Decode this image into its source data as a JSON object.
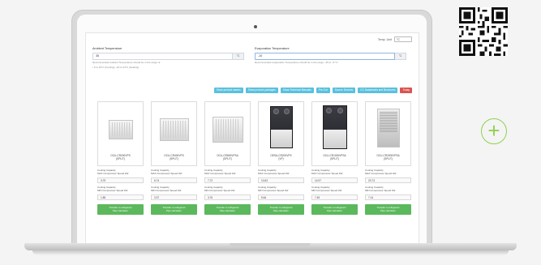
{
  "colors": {
    "primary_button": "#5bc0de",
    "danger_button": "#d9534f",
    "go_button": "#5cb85c",
    "accent_plus": "#8fd14f"
  },
  "units": {
    "label": "Temp. Unit",
    "value": "°C"
  },
  "ambient": {
    "label": "Ambient Temperature",
    "value": "35",
    "unit": "°C",
    "hint_line1": "Recommended ambient Temperature should be in the range of",
    "hint_line2": "• 5 to 43°C (Cooling)  –20 to 24°C (Heating)"
  },
  "evaporation": {
    "label": "Evaporation Temperature",
    "value": "-10",
    "unit": "°C",
    "hint": "Recommended evaporation Temperature should be in the range –45 to –5 °C"
  },
  "toolbar": [
    {
      "label": "Show product names",
      "color": "#5bc0de"
    },
    {
      "label": "Show product packages",
      "color": "#5bc0de"
    },
    {
      "label": "Show Technical Manuals",
      "color": "#5bc0de"
    },
    {
      "label": "Pre-Cut",
      "color": "#5bc0de"
    },
    {
      "label": "Source Devices",
      "color": "#5bc0de"
    },
    {
      "label": "CO Datasheets and Brochures",
      "color": "#5bc0de"
    },
    {
      "label": "Today",
      "color": "#d9534f"
    }
  ],
  "cards": [
    {
      "name": "OCU-CR200VPS",
      "model": "(SPLIT)",
      "image": "condensing-unit-small",
      "cap_label1": "Cooling Capacity",
      "cap_label1b": "MAX Compressor Speed kW",
      "cap_value": "3.79",
      "cap_label2": "Cooling Capacity",
      "cap_label2b": "MIN Compressor Speed kW",
      "cap_value2": "1.85",
      "button_line1": "Transfer to refrigerant",
      "button_line2": "Pipe calculator"
    },
    {
      "name": "OCU-CR400VPS",
      "model": "(SPLIT)",
      "image": "condensing-unit-medium",
      "cap_label1": "Cooling Capacity",
      "cap_label1b": "MAX Compressor Speed kW",
      "cap_value": "6.74",
      "cap_label2": "Cooling Capacity",
      "cap_label2b": "MIN Compressor Speed kW",
      "cap_value2": "3.37",
      "button_line1": "Transfer to refrigerant",
      "button_line2": "Pipe calculator"
    },
    {
      "name": "OCU-CR800VPSA",
      "model": "(SPLIT)",
      "image": "condensing-unit-large",
      "cap_label1": "Cooling Capacity",
      "cap_label1b": "MAX Compressor Speed kW",
      "cap_value": "7.72",
      "cap_label2": "Cooling Capacity",
      "cap_label2b": "MIN Compressor Speed kW",
      "cap_value2": "3.76",
      "button_line1": "Transfer to refrigerant",
      "button_line2": "Pipe calculator"
    },
    {
      "name": "OESA-CR200VPS",
      "model": "(VP)",
      "image": "vertical-unit-dark",
      "cap_label1": "Cooling Capacity",
      "cap_label1b": "MAX Compressor Speed kW",
      "cap_value": "10.63",
      "cap_label2": "Cooling Capacity",
      "cap_label2b": "MIN Compressor Speed kW",
      "cap_value2": "5.64",
      "button_line1": "Transfer to refrigerant",
      "button_line2": "Pipe calculator"
    },
    {
      "name": "OCU-CR1000VPSA",
      "model": "(SPLIT)",
      "image": "vertical-unit-dark-2",
      "cap_label1": "Cooling Capacity",
      "cap_label1b": "MAX Compressor Speed kW",
      "cap_value": "14.97",
      "cap_label2": "Cooling Capacity",
      "cap_label2b": "MIN Compressor Speed kW",
      "cap_value2": "7.49",
      "button_line1": "Transfer to refrigerant",
      "button_line2": "Pipe calculator"
    },
    {
      "name": "OCU-CR2000VPSA",
      "model": "(SPLIT)",
      "image": "condensing-unit-silver",
      "cap_label1": "Cooling Capacity",
      "cap_label1b": "MAX Compressor Speed kW",
      "cap_value": "23.73",
      "cap_label2": "Cooling Capacity",
      "cap_label2b": "MIN Compressor Speed kW",
      "cap_value2": "7.14",
      "button_line1": "Transfer to refrigerant",
      "button_line2": "Pipe calculator"
    }
  ],
  "side": {
    "plus_icon": "plus-circle-icon",
    "qr_icon": "qr-code-icon"
  }
}
